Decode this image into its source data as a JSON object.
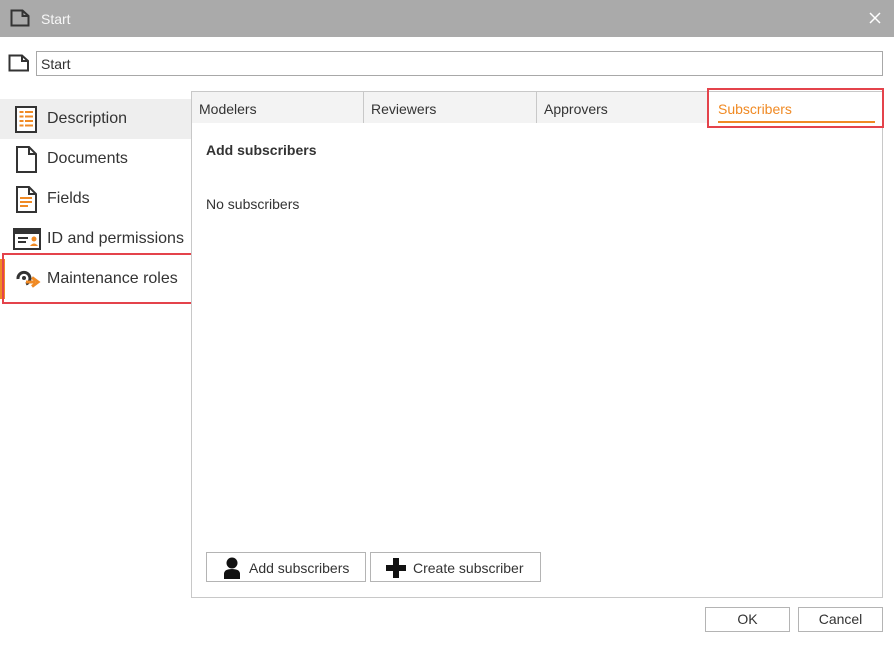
{
  "window": {
    "title": "Start",
    "icon": "document-icon",
    "close_icon": "close-icon"
  },
  "name_field": {
    "value": "Start",
    "icon": "document-icon"
  },
  "sidebar": {
    "items": [
      {
        "label": "Description",
        "icon": "description-icon"
      },
      {
        "label": "Documents",
        "icon": "documents-icon"
      },
      {
        "label": "Fields",
        "icon": "fields-icon"
      },
      {
        "label": "ID and permissions",
        "icon": "id-card-icon"
      },
      {
        "label": "Maintenance roles",
        "icon": "maintenance-roles-icon"
      }
    ]
  },
  "tabs": [
    {
      "label": "Modelers"
    },
    {
      "label": "Reviewers"
    },
    {
      "label": "Approvers"
    },
    {
      "label": "Subscribers"
    }
  ],
  "content": {
    "heading": "Add subscribers",
    "empty_text": "No subscribers"
  },
  "panel_buttons": {
    "add_label": "Add subscribers",
    "create_label": "Create subscriber"
  },
  "footer": {
    "ok_label": "OK",
    "cancel_label": "Cancel"
  },
  "colors": {
    "accent": "#f08a24",
    "highlight": "#e4434b",
    "titlebar": "#aaaaaa"
  }
}
